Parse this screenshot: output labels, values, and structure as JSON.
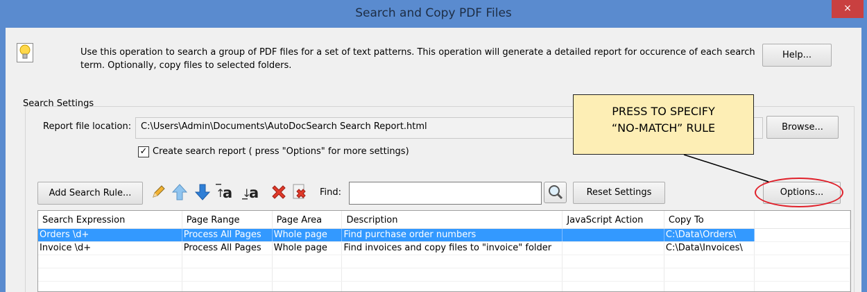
{
  "window": {
    "title": "Search and Copy PDF Files",
    "close_glyph": "×"
  },
  "intro": {
    "text": "Use this operation to search a group of PDF files for a set of text patterns. This operation will generate a detailed report for occurence of each search term. Optionally, copy files to selected folders.",
    "icon": "lightbulb-icon"
  },
  "help_button": "Help...",
  "search_settings": {
    "label": "Search Settings",
    "report_label": "Report file location:",
    "report_value": "C:\\Users\\Admin\\Documents\\AutoDocSearch Search Report.html",
    "browse_button": "Browse...",
    "create_report_checked": true,
    "create_report_label": "Create search report ( press \"Options\" for more settings)"
  },
  "toolbar": {
    "add_rule_button": "Add Search Rule...",
    "icons": [
      "pencil-icon",
      "move-up-icon",
      "move-down-icon",
      "upper-case-icon",
      "lower-case-icon",
      "delete-icon",
      "delete-all-icon"
    ],
    "find_label": "Find:",
    "find_value": "",
    "reset_button": "Reset Settings",
    "options_button": "Options..."
  },
  "callout": {
    "line1": "PRESS TO SPECIFY",
    "line2": "“NO-MATCH” RULE"
  },
  "table": {
    "columns": [
      "Search Expression",
      "Page Range",
      "Page Area",
      "Description",
      "JavaScript Action",
      "Copy To"
    ],
    "rows": [
      {
        "expression": "Orders \\d+",
        "range": "Process All Pages",
        "area": "Whole page",
        "description": "Find purchase order numbers",
        "js": "",
        "copy_to": "C:\\Data\\Orders\\",
        "selected": true
      },
      {
        "expression": "Invoice \\d+",
        "range": "Process All Pages",
        "area": "Whole page",
        "description": "Find invoices and copy files to \"invoice\" folder",
        "js": "",
        "copy_to": "C:\\Data\\Invoices\\",
        "selected": false
      }
    ]
  },
  "colors": {
    "titlebar": "#5a8bcf",
    "close": "#c94040",
    "selection": "#3399ff",
    "callout_fill": "#fdeeb5",
    "highlight_ellipse": "#e0202a"
  }
}
